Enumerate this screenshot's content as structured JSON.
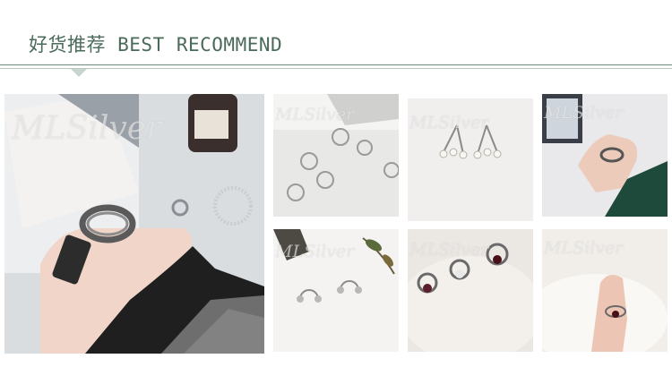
{
  "header": {
    "title": "好货推荐 BEST RECOMMEND"
  },
  "watermark": {
    "text": "MLSilver"
  },
  "colors": {
    "title": "#4a6b5a",
    "rule": "#6d8a7b",
    "notch": "#c9d6cf"
  },
  "gallery": [
    {
      "subject": "hand-stacked-rings-with-wine-bottle"
    },
    {
      "subject": "thin-silver-rings-scattered"
    },
    {
      "subject": "pearl-drop-earrings"
    },
    {
      "subject": "chain-ring-on-hand"
    },
    {
      "subject": "open-ball-rings-with-leaves"
    },
    {
      "subject": "gemstone-rings-on-fur"
    },
    {
      "subject": "red-stone-ring-on-finger"
    }
  ]
}
